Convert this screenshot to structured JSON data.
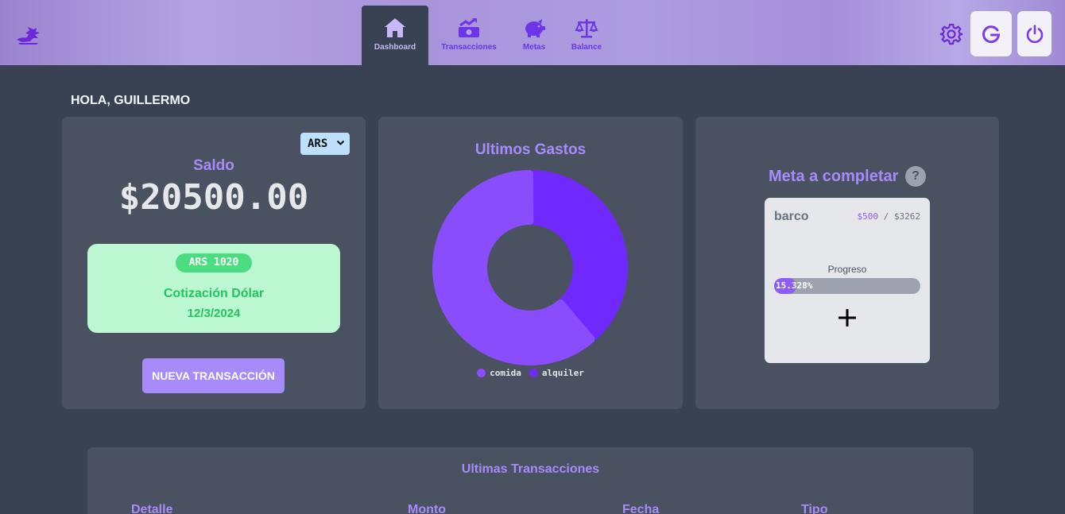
{
  "nav": {
    "items": [
      {
        "label": "Dashboard",
        "icon": "house-icon",
        "active": true
      },
      {
        "label": "Transacciones",
        "icon": "money-trend-icon",
        "active": false
      },
      {
        "label": "Metas",
        "icon": "piggy-bank-icon",
        "active": false
      },
      {
        "label": "Balance",
        "icon": "scale-icon",
        "active": false
      }
    ]
  },
  "header": {
    "settings_icon": "gear-icon",
    "google_icon": "google-g-icon",
    "logout_icon": "power-icon"
  },
  "greeting": "HOLA, GUILLERMO",
  "saldo": {
    "currency_selected": "ARS",
    "label": "Saldo",
    "symbol": "$",
    "amount": "20500.00"
  },
  "dolar": {
    "pill": "ARS 1020",
    "title": "Cotización Dólar",
    "date": "12/3/2024"
  },
  "new_transaction_label": "NUEVA TRANSACCIÓN",
  "gastos": {
    "title": "Ultimos Gastos"
  },
  "chart_data": {
    "type": "pie",
    "title": "Ultimos Gastos",
    "categories": [
      "comida",
      "alquiler"
    ],
    "values": [
      62,
      38
    ],
    "colors": [
      "#8a4dfd",
      "#7029fd"
    ],
    "legend": "bottom",
    "donut": true
  },
  "meta": {
    "title": "Meta a completar",
    "help": "?",
    "goal_name": "barco",
    "current": "$500",
    "separator": "/",
    "target": "$3262",
    "progress_label": "Progreso",
    "progress_text": "15.328%",
    "progress_fraction": 0.15328,
    "add_icon": "plus-icon"
  },
  "transactions": {
    "title": "Ultimas Transacciones",
    "columns": [
      "Detalle",
      "Monto",
      "Fecha",
      "Tipo"
    ]
  },
  "colors": {
    "accent": "#a78bfa",
    "bg": "#384253",
    "card": "#4a5261",
    "green": "#22c55e"
  }
}
